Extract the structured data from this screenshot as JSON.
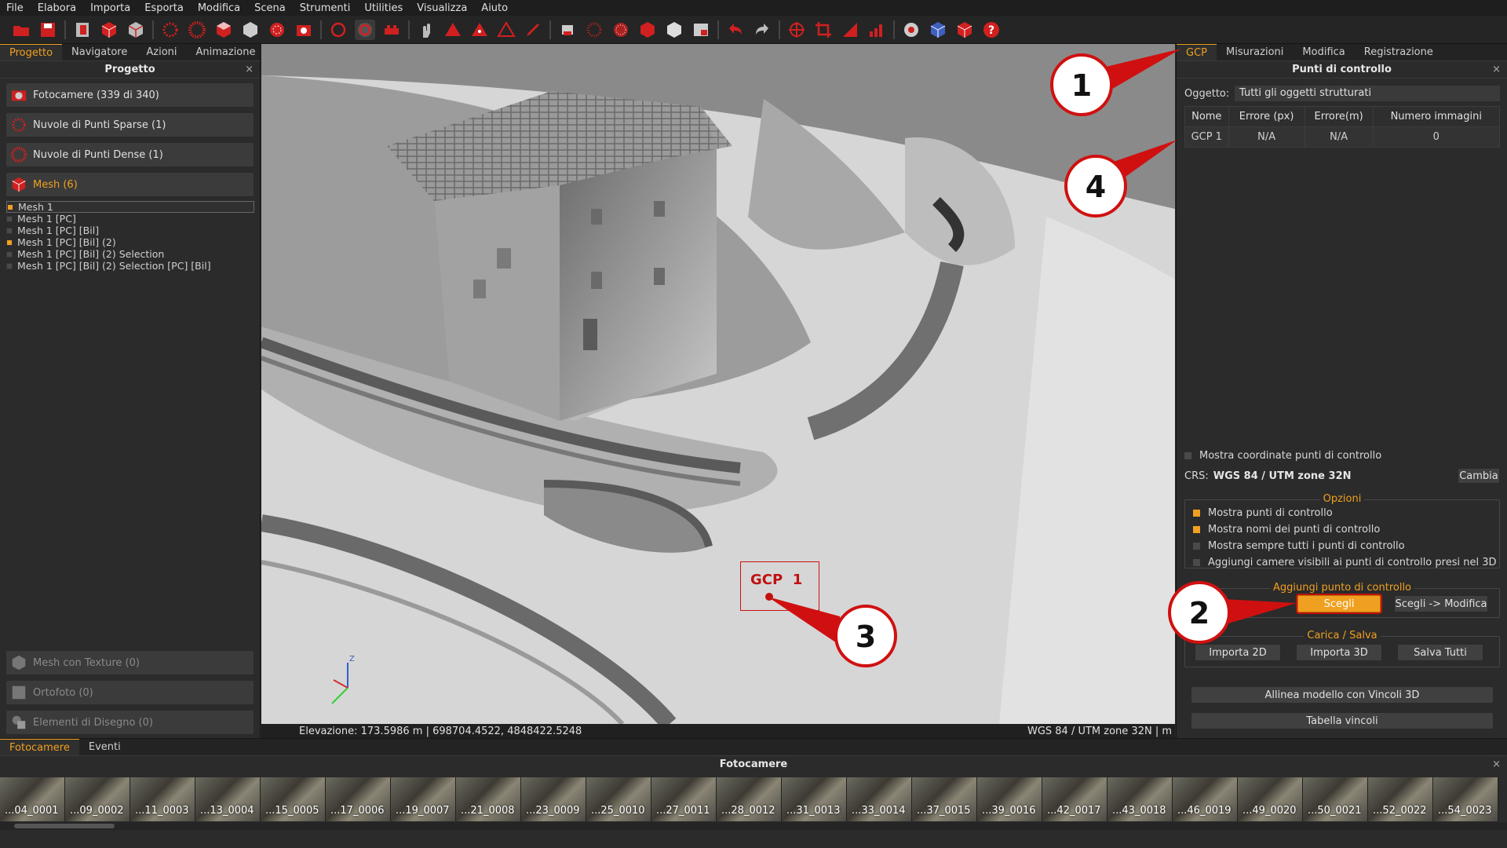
{
  "menu": [
    "File",
    "Elabora",
    "Importa",
    "Esporta",
    "Modifica",
    "Scena",
    "Strumenti",
    "Utilities",
    "Visualizza",
    "Aiuto"
  ],
  "left_panel": {
    "tabs": [
      "Progetto",
      "Navigatore",
      "Azioni",
      "Animazione"
    ],
    "title": "Progetto",
    "close": "×",
    "categories": [
      "Fotocamere (339 di 340)",
      "Nuvole di Punti Sparse (1)",
      "Nuvole di Punti Dense (1)",
      "Mesh (6)"
    ],
    "mesh_items": [
      "Mesh 1",
      "Mesh 1 [PC]",
      "Mesh 1 [PC] [Bil]",
      "Mesh 1 [PC] [Bil] (2)",
      "Mesh 1 [PC] [Bil] (2) Selection",
      "Mesh 1 [PC] [Bil] (2) Selection [PC] [Bil]"
    ],
    "bottom_categories": [
      "Mesh con Texture (0)",
      "Ortofoto (0)",
      "Elementi di Disegno (0)"
    ]
  },
  "viewport": {
    "gcp_label": "GCP  1",
    "axis_z": "Z",
    "status_left": "Elevazione: 173.5986 m | 698704.4522, 4848422.5248",
    "status_right": "WGS 84 / UTM zone 32N | m"
  },
  "right_panel": {
    "tabs": [
      "GCP",
      "Misurazioni",
      "Modifica",
      "Registrazione"
    ],
    "title": "Punti di controllo",
    "close": "×",
    "object_label": "Oggetto:",
    "object_value": "Tutti gli oggetti strutturati",
    "table_headers": [
      "Nome",
      "Errore (px)",
      "Errore(m)",
      "Numero immagini"
    ],
    "table_rows": [
      [
        "GCP 1",
        "N/A",
        "N/A",
        "0"
      ]
    ],
    "show_coords": "Mostra coordinate punti di controllo",
    "crs_label": "CRS:",
    "crs_value": "WGS 84 / UTM zone 32N",
    "change": "Cambia",
    "options_title": "Opzioni",
    "options": [
      "Mostra punti di controllo",
      "Mostra nomi dei punti di controllo",
      "Mostra sempre tutti i punti di controllo",
      "Aggiungi camere visibili ai punti di controllo presi nel 3D"
    ],
    "add_title": "Aggiungi punto di controllo",
    "pick": "Scegli",
    "pick_edit": "Scegli -> Modifica",
    "load_title": "Carica / Salva",
    "import2d": "Importa 2D",
    "import3d": "Importa 3D",
    "save_all": "Salva Tutti",
    "align": "Allinea modello con Vincoli 3D",
    "constraints": "Tabella vincoli"
  },
  "bottom_panel": {
    "tabs": [
      "Fotocamere",
      "Eventi"
    ],
    "title": "Fotocamere",
    "close": "×",
    "thumbs": [
      "...04_0001",
      "...09_0002",
      "...11_0003",
      "...13_0004",
      "...15_0005",
      "...17_0006",
      "...19_0007",
      "...21_0008",
      "...23_0009",
      "...25_0010",
      "...27_0011",
      "...28_0012",
      "...31_0013",
      "...33_0014",
      "...37_0015",
      "...39_0016",
      "...42_0017",
      "...43_0018",
      "...46_0019",
      "...49_0020",
      "...50_0021",
      "...52_0022",
      "...54_0023"
    ]
  },
  "callouts": [
    "1",
    "2",
    "3",
    "4"
  ],
  "colors": {
    "accent": "#f0a020",
    "callout_red": "#d01010",
    "icon_red": "#d02020"
  }
}
